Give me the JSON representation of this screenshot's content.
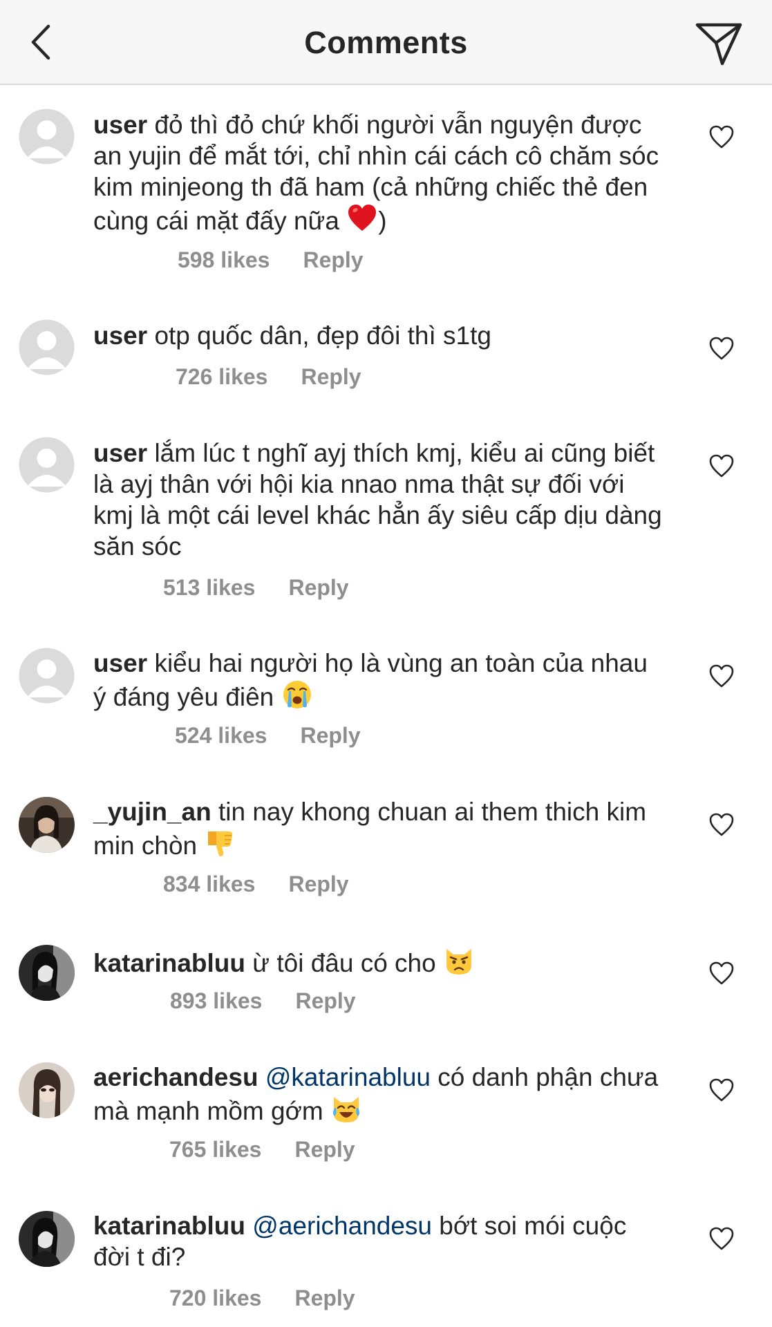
{
  "header": {
    "title": "Comments",
    "back_icon": "chevron-left-icon",
    "send_icon": "paper-plane-icon"
  },
  "comments": [
    {
      "username": "user",
      "text": "đỏ thì đỏ chứ khối người vẫn nguyện được an yujin để mắt tới, chỉ nhìn cái cách cô chăm sóc kim minjeong th đã ham (cả những chiếc thẻ đen cùng cái mặt đấy nữa",
      "text_end": ")",
      "emoji": "red-heart-emoji",
      "likes": "598 likes",
      "reply": "Reply",
      "avatar": "default-avatar"
    },
    {
      "username": "user",
      "text": "otp quốc dân, đẹp đôi thì s1tg",
      "likes": "726 likes",
      "reply": "Reply",
      "avatar": "default-avatar"
    },
    {
      "username": "user",
      "text": "lắm lúc t nghĩ ayj thích kmj, kiểu ai cũng biết là ayj thân với hội kia nnao nma thật sự đối với kmj là một cái level khác hẳn ấy siêu cấp dịu dàng săn sóc",
      "likes": "513 likes",
      "reply": "Reply",
      "avatar": "default-avatar"
    },
    {
      "username": "user",
      "text": "kiểu hai người họ là vùng an toàn của nhau ý đáng yêu điên",
      "emoji": "loudly-crying-face-emoji",
      "likes": "524 likes",
      "reply": "Reply",
      "avatar": "default-avatar"
    },
    {
      "username": "_yujin_an",
      "text": "tin nay khong chuan ai them thich kim min chòn",
      "emoji": "thumbs-down-emoji",
      "likes": "834 likes",
      "reply": "Reply",
      "avatar": "photo-avatar"
    },
    {
      "username": "katarinabluu",
      "text": "ừ tôi đâu có cho",
      "emoji": "pouting-cat-emoji",
      "likes": "893 likes",
      "reply": "Reply",
      "avatar": "photo-avatar"
    },
    {
      "username": "aerichandesu",
      "mention": "@katarinabluu",
      "text": "có danh phận chưa mà mạnh mồm gớm",
      "emoji": "cat-tears-of-joy-emoji",
      "likes": "765 likes",
      "reply": "Reply",
      "avatar": "photo-avatar"
    },
    {
      "username": "katarinabluu",
      "mention": "@aerichandesu",
      "text": "bớt soi mói cuộc đời t đi?",
      "likes": "720 likes",
      "reply": "Reply",
      "avatar": "photo-avatar"
    }
  ],
  "colors": {
    "text": "#262626",
    "meta": "#8e8e8e",
    "mention": "#003569",
    "header_bg": "#f7f7f7"
  }
}
